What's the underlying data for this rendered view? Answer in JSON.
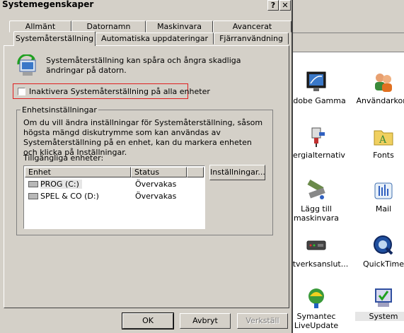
{
  "dialog": {
    "title": "Systemegenskaper",
    "help_label": "?",
    "close_label": "✕"
  },
  "tabs_row1": [
    "Allmänt",
    "Datornamn",
    "Maskinvara",
    "Avancerat"
  ],
  "tabs_row2": [
    "Systemåterställning",
    "Automatiska uppdateringar",
    "Fjärranvändning"
  ],
  "active_tab": "Systemåterställning",
  "system_restore": {
    "description": "Systemåterställning kan spåra och ångra skadliga ändringar på datorn.",
    "disable_checkbox_label": "Inaktivera Systemåterställning på alla enheter",
    "disable_checked": false,
    "highlight_color": "#e02020"
  },
  "drive_settings": {
    "legend": "Enhetsinställningar",
    "description": "Om du vill ändra inställningar för Systemåterställning, såsom högsta mängd diskutrymme som kan användas av Systemåterställning på en enhet, kan du markera enheten och klicka på Inställningar.",
    "available_label": "Tillgängliga enheter:",
    "columns": [
      "Enhet",
      "Status"
    ],
    "drives": [
      {
        "name": "PROG (C:)",
        "status": "Övervakas",
        "selected": true
      },
      {
        "name": "SPEL & CO (D:)",
        "status": "Övervakas",
        "selected": false
      }
    ],
    "settings_button": "Inställningar..."
  },
  "buttons": {
    "ok": "OK",
    "cancel": "Avbryt",
    "apply": "Verkställ"
  },
  "background_icons": [
    {
      "label": "Adobe Gamma",
      "icon": "monitor-icon"
    },
    {
      "label": "Användarkont",
      "icon": "users-icon"
    },
    {
      "label": "nergialternativ",
      "icon": "power-icon"
    },
    {
      "label": "Fonts",
      "icon": "fonts-folder-icon"
    },
    {
      "label": "Lägg till maskinvara",
      "icon": "add-hardware-icon"
    },
    {
      "label": "Mail",
      "icon": "mail-icon"
    },
    {
      "label": "atverksanslut...",
      "icon": "network-icon"
    },
    {
      "label": "QuickTime",
      "icon": "quicktime-icon"
    },
    {
      "label": "Symantec LiveUpdate",
      "icon": "liveupdate-icon"
    },
    {
      "label": "System",
      "icon": "system-icon"
    }
  ]
}
